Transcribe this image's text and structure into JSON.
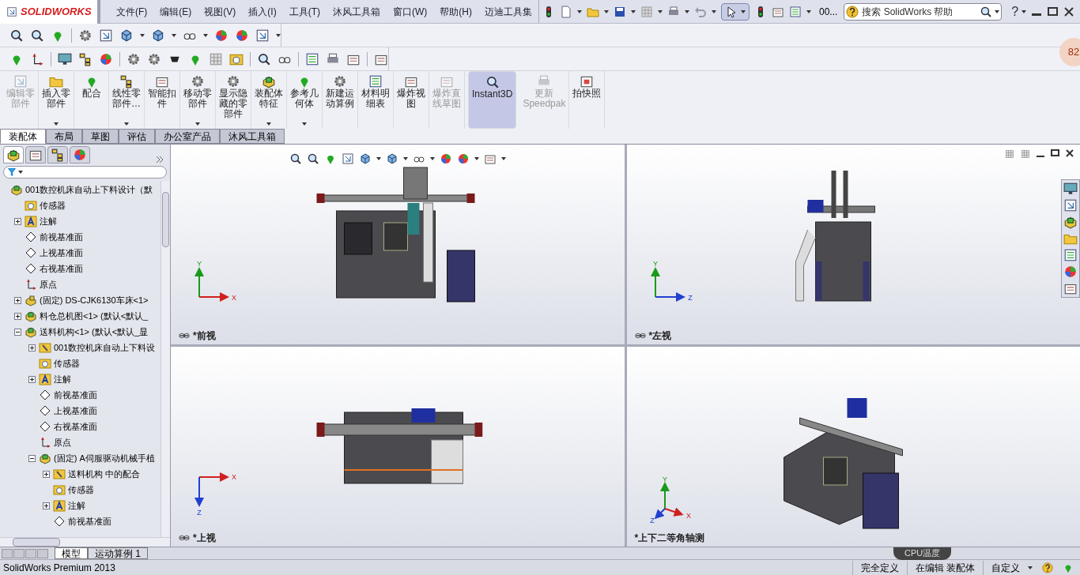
{
  "app": {
    "logo": "SOLIDWORKS",
    "menus": [
      "文件(F)",
      "编辑(E)",
      "视图(V)",
      "插入(I)",
      "工具(T)",
      "沐风工具箱",
      "窗口(W)",
      "帮助(H)",
      "迈迪工具集"
    ],
    "toolbar_text": "00...",
    "search": {
      "placeholder": "搜索 SolidWorks 帮助"
    },
    "help": "?"
  },
  "command_manager": [
    {
      "lines": [
        "编辑零",
        "部件"
      ],
      "disabled": true,
      "dropdown": false,
      "selected": false
    },
    {
      "lines": [
        "插入零",
        "部件"
      ],
      "disabled": false,
      "dropdown": true,
      "selected": false
    },
    {
      "lines": [
        "配合"
      ],
      "disabled": false,
      "dropdown": false,
      "selected": false
    },
    {
      "lines": [
        "线性零",
        "部件…"
      ],
      "disabled": false,
      "dropdown": true,
      "selected": false
    },
    {
      "lines": [
        "智能扣",
        "件"
      ],
      "disabled": false,
      "dropdown": false,
      "selected": false
    },
    {
      "lines": [
        "移动零",
        "部件"
      ],
      "disabled": false,
      "dropdown": true,
      "selected": false
    },
    {
      "lines": [
        "显示隐",
        "藏的零",
        "部件"
      ],
      "disabled": false,
      "dropdown": false,
      "selected": false
    },
    {
      "lines": [
        "装配体",
        "特征"
      ],
      "disabled": false,
      "dropdown": true,
      "selected": false
    },
    {
      "lines": [
        "参考几",
        "何体"
      ],
      "disabled": false,
      "dropdown": true,
      "selected": false
    },
    {
      "lines": [
        "新建运",
        "动算例"
      ],
      "disabled": false,
      "dropdown": false,
      "selected": false
    },
    {
      "lines": [
        "材料明",
        "细表"
      ],
      "disabled": false,
      "dropdown": false,
      "selected": false
    },
    {
      "lines": [
        "爆炸视",
        "图"
      ],
      "disabled": false,
      "dropdown": false,
      "selected": false
    },
    {
      "lines": [
        "爆炸直",
        "线草图"
      ],
      "disabled": true,
      "dropdown": false,
      "selected": false
    },
    {
      "lines": [
        "Instant3D"
      ],
      "disabled": false,
      "dropdown": false,
      "selected": true
    },
    {
      "lines": [
        "更新",
        "Speedpak"
      ],
      "disabled": true,
      "dropdown": false,
      "selected": false
    },
    {
      "lines": [
        "拍快照"
      ],
      "disabled": false,
      "dropdown": false,
      "selected": false
    }
  ],
  "command_tabs": [
    {
      "label": "装配体",
      "selected": true
    },
    {
      "label": "布局",
      "selected": false
    },
    {
      "label": "草图",
      "selected": false
    },
    {
      "label": "评估",
      "selected": false
    },
    {
      "label": "办公室产品",
      "selected": false
    },
    {
      "label": "沐风工具箱",
      "selected": false
    }
  ],
  "panel_tabs": [
    {
      "selected": true
    },
    {
      "selected": false
    },
    {
      "selected": false
    },
    {
      "selected": false
    }
  ],
  "tree": [
    {
      "kind": "assembly",
      "label": "001数控机床自动上下料设计（默",
      "children": [
        {
          "kind": "sensor",
          "label": "传感器"
        },
        {
          "kind": "annotation",
          "label": "注解",
          "expanded": false
        },
        {
          "kind": "plane",
          "label": "前视基准面"
        },
        {
          "kind": "plane",
          "label": "上视基准面"
        },
        {
          "kind": "plane",
          "label": "右视基准面"
        },
        {
          "kind": "origin",
          "label": "原点"
        },
        {
          "kind": "part",
          "label": "(固定) DS-CJK6130车床<1>",
          "expanded": false
        },
        {
          "kind": "assembly",
          "label": "料仓总机图<1> (默认<默认_",
          "expanded": false
        },
        {
          "kind": "assembly",
          "label": "送料机构<1> (默认<默认_显",
          "expanded": true,
          "children": [
            {
              "kind": "mates",
              "label": "001数控机床自动上下料设",
              "expanded": false
            },
            {
              "kind": "sensor",
              "label": "传感器"
            },
            {
              "kind": "annotation",
              "label": "注解",
              "expanded": false
            },
            {
              "kind": "plane",
              "label": "前视基准面"
            },
            {
              "kind": "plane",
              "label": "上视基准面"
            },
            {
              "kind": "plane",
              "label": "右视基准面"
            },
            {
              "kind": "origin",
              "label": "原点"
            },
            {
              "kind": "assembly",
              "label": "(固定) A伺服驱动机械手植",
              "expanded": true,
              "children": [
                {
                  "kind": "mates",
                  "label": "送料机构 中的配合",
                  "expanded": false
                },
                {
                  "kind": "sensor",
                  "label": "传感器"
                },
                {
                  "kind": "annotation",
                  "label": "注解",
                  "expanded": false
                },
                {
                  "kind": "plane",
                  "label": "前视基准面"
                }
              ]
            }
          ]
        }
      ]
    }
  ],
  "viewports": [
    {
      "kind": "front",
      "label": "*前视",
      "axes": [
        "Y",
        "X"
      ]
    },
    {
      "kind": "left",
      "label": "*左视",
      "axes": [
        "Y",
        "Z"
      ]
    },
    {
      "kind": "top",
      "label": "*上视",
      "axes": [
        "X",
        "Z"
      ]
    },
    {
      "kind": "iso",
      "label": "*上下二等角轴测",
      "axes": [
        "Y",
        "X",
        "Z"
      ]
    }
  ],
  "bottom_tabs": [
    {
      "label": "模型",
      "selected": true
    },
    {
      "label": "运动算例 1",
      "selected": false
    }
  ],
  "status_bar": {
    "product": "SolidWorks Premium 2013",
    "fields": [
      "完全定义",
      "在编辑 装配体",
      "自定义"
    ]
  },
  "overlay": {
    "temperature": "82",
    "cpu_label": "CPU温度"
  }
}
